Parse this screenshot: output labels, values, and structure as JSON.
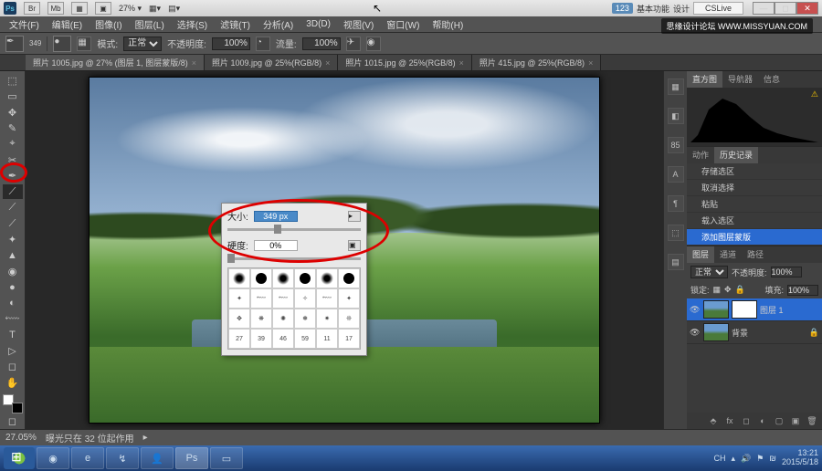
{
  "titlebar": {
    "zoom": "27%",
    "workspace_badge": "123",
    "workspace_labels": [
      "基本功能",
      "设计"
    ],
    "search_hint": "CSLive",
    "tb_icons": [
      "Br",
      "Mb",
      "▦",
      "▣"
    ]
  },
  "watermark": "思缘设计论坛  WWW.MISSYUAN.COM",
  "menu": [
    "文件(F)",
    "编辑(E)",
    "图像(I)",
    "图层(L)",
    "选择(S)",
    "滤镜(T)",
    "分析(A)",
    "3D(D)",
    "视图(V)",
    "窗口(W)",
    "帮助(H)"
  ],
  "optbar": {
    "size_label": "349",
    "mode_label": "模式:",
    "mode_value": "正常",
    "opacity_label": "不透明度:",
    "opacity_value": "100%",
    "flow_label": "流量:",
    "flow_value": "100%"
  },
  "tabs": [
    {
      "label": "照片 1005.jpg @ 27% (图层 1, 图层蒙版/8)",
      "active": true
    },
    {
      "label": "照片 1009.jpg @ 25%(RGB/8)",
      "active": false
    },
    {
      "label": "照片 1015.jpg @ 25%(RGB/8)",
      "active": false
    },
    {
      "label": "照片 415.jpg @ 25%(RGB/8)",
      "active": false
    }
  ],
  "tools": [
    "⬚",
    "▭",
    "✥",
    "✎",
    "⌖",
    "✂",
    "✒",
    "⟋",
    "⟋",
    "⟋",
    "✦",
    "▲",
    "◉",
    "●",
    "◐",
    "✥",
    "⬳",
    "T",
    "▷",
    "◻",
    "✋",
    "🔍"
  ],
  "brush_popup": {
    "size_label": "大小:",
    "size_value": "349 px",
    "hardness_label": "硬度:",
    "hardness_value": "0%",
    "preset_labels": [
      "",
      "",
      "",
      "",
      "",
      "",
      "",
      "",
      "",
      "",
      "",
      "",
      "",
      "",
      "",
      "",
      "",
      "",
      "27",
      "39",
      "46",
      "59",
      "11",
      "17"
    ]
  },
  "right_rail": [
    "▦",
    "◧",
    "85",
    "A",
    "¶",
    "⬚",
    "▤"
  ],
  "panels": {
    "nav_tabs": [
      "直方图",
      "导航器",
      "信息"
    ],
    "history_tabs": [
      "动作",
      "历史记录"
    ],
    "history_items": [
      {
        "label": "存储选区",
        "sel": false
      },
      {
        "label": "取消选择",
        "sel": false
      },
      {
        "label": "粘贴",
        "sel": false
      },
      {
        "label": "载入选区",
        "sel": false
      },
      {
        "label": "添加图层蒙版",
        "sel": true
      }
    ],
    "layers_tabs": [
      "图层",
      "通道",
      "路径"
    ],
    "layers": {
      "blend_mode": "正常",
      "opacity_label": "不透明度:",
      "opacity_value": "100%",
      "lock_label": "锁定:",
      "fill_label": "填充:",
      "fill_value": "100%",
      "items": [
        {
          "name": "图层 1",
          "sel": true,
          "mask": true
        },
        {
          "name": "背景",
          "sel": false,
          "mask": false
        }
      ]
    }
  },
  "status": {
    "zoom": "27.05%",
    "info": "曝光只在 32 位起作用"
  },
  "taskbar": {
    "apps": [
      "◉",
      "e",
      "↯",
      "👤",
      "Ps",
      "▭"
    ],
    "tray_icons": [
      "CH",
      "🔊",
      "⚑",
      "₪"
    ],
    "time": "13:21",
    "date": "2015/5/18"
  }
}
